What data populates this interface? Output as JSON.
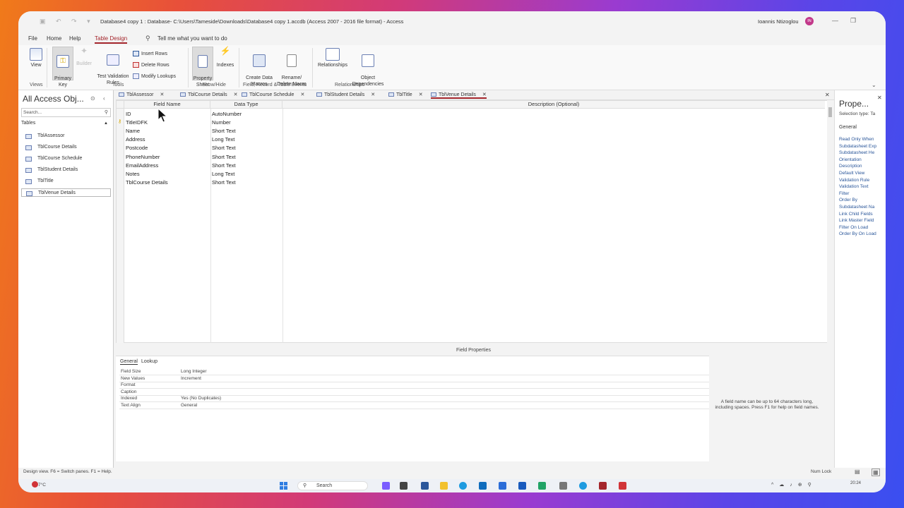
{
  "window": {
    "title": "Database4 copy 1 : Database- C:\\Users\\Tameside\\Downloads\\Database4 copy 1.accdb (Access 2007 - 2016 file format) - Access",
    "user_name": "Ioannis Ntizoglou",
    "user_initials": "IN"
  },
  "menu": {
    "tabs": [
      "File",
      "Home",
      "Help",
      "Table Design"
    ],
    "active_tab": "Table Design",
    "tell_me": "Tell me what you want to do"
  },
  "ribbon": {
    "view": "View",
    "primary_key": "Primary\nKey",
    "builder": "Builder",
    "test_validation": "Test Validation\nRules",
    "insert_rows": "Insert Rows",
    "delete_rows": "Delete Rows",
    "modify_lookups": "Modify Lookups",
    "property_sheet": "Property\nSheet",
    "indexes": "Indexes",
    "create_data_macros": "Create Data\nMacros",
    "rename_delete_macro": "Rename/\nDelete Macro",
    "relationships": "Relationships",
    "object_dependencies": "Object\nDependencies",
    "groups": {
      "views": "Views",
      "tools": "Tools",
      "show_hide": "Show/Hide",
      "field_events": "Field, Record & Table Events",
      "relationships": "Relationships"
    }
  },
  "nav": {
    "title": "All Access Obj...",
    "search_placeholder": "Search...",
    "section": "Tables",
    "items": [
      "TblAssessor",
      "TblCourse Details",
      "TblCourse Schedule",
      "TblStudent Details",
      "TblTitle",
      "TblVenue Details"
    ],
    "selected": "TblVenue Details"
  },
  "doc_tabs": {
    "tabs": [
      "TblAssessor",
      "TblCourse Details",
      "TblCourse Schedule",
      "TblStudent Details",
      "TblTitle",
      "TblVenue Details"
    ],
    "active": "TblVenue Details"
  },
  "design_grid": {
    "headers": [
      "Field Name",
      "Data Type",
      "Description (Optional)"
    ],
    "rows": [
      {
        "field": "ID",
        "type": "AutoNumber"
      },
      {
        "field": "TitleIDFK",
        "type": "Number"
      },
      {
        "field": "Name",
        "type": "Short Text"
      },
      {
        "field": "Address",
        "type": "Long Text"
      },
      {
        "field": "Postcode",
        "type": "Short Text"
      },
      {
        "field": "PhoneNumber",
        "type": "Short Text"
      },
      {
        "field": "EmailAddress",
        "type": "Short Text"
      },
      {
        "field": "Notes",
        "type": "Long Text"
      },
      {
        "field": "TblCourse Details",
        "type": "Short Text"
      }
    ]
  },
  "field_properties": {
    "label": "Field Properties",
    "tabs": [
      "General",
      "Lookup"
    ],
    "rows": [
      {
        "k": "Field Size",
        "v": "Long Integer"
      },
      {
        "k": "New Values",
        "v": "Increment"
      },
      {
        "k": "Format",
        "v": ""
      },
      {
        "k": "Caption",
        "v": ""
      },
      {
        "k": "Indexed",
        "v": "Yes (No Duplicates)"
      },
      {
        "k": "Text Align",
        "v": "General"
      }
    ],
    "help": "A field name can be up to 64 characters long, including spaces. Press F1 for help on field names."
  },
  "property_sheet": {
    "title": "Prope...",
    "selection_type": "Selection type: Ta",
    "tab": "General",
    "props": [
      "Read Only When",
      "Subdatasheet Exp",
      "Subdatasheet He",
      "Orientation",
      "Description",
      "Default View",
      "Validation Rule",
      "Validation Text",
      "Filter",
      "Order By",
      "Subdatasheet Na",
      "Link Child Fields",
      "Link Master Field",
      "Filter On Load",
      "Order By On Load"
    ]
  },
  "status": {
    "left": "Design view.  F6 = Switch panes.  F1 = Help.",
    "num_lock": "Num Lock"
  },
  "taskbar": {
    "weather": "7°C",
    "search": "Search",
    "time": "20:24"
  },
  "colors": {
    "accent": "#a4262c",
    "link": "#2b579a"
  }
}
